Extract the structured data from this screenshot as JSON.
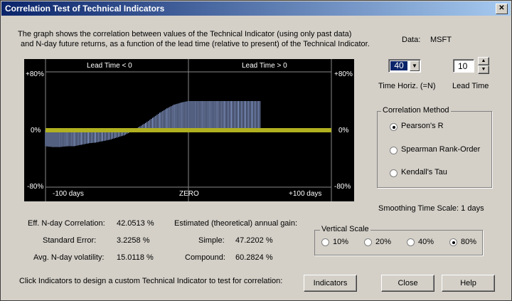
{
  "window": {
    "title": "Correlation Test of Technical Indicators"
  },
  "description": {
    "line1": "The graph shows the correlation between values of the Technical Indicator (using only past data)",
    "line2": "and N-day future returns, as a function of the lead time (relative to present) of the Technical Indicator."
  },
  "data_label": "Data:",
  "data_value": "MSFT",
  "controls": {
    "time_horiz_value": "40",
    "time_horiz_label": "Time Horiz. (=N)",
    "lead_time_value": "10",
    "lead_time_label": "Lead Time"
  },
  "correlation_method": {
    "title": "Correlation Method",
    "options": [
      {
        "label": "Pearson's R",
        "selected": true
      },
      {
        "label": "Spearman Rank-Order",
        "selected": false
      },
      {
        "label": "Kendall's Tau",
        "selected": false
      }
    ]
  },
  "smoothing": "Smoothing Time Scale:  1 days",
  "vertical_scale": {
    "title": "Vertical Scale",
    "options": [
      {
        "label": "10%",
        "selected": false
      },
      {
        "label": "20%",
        "selected": false
      },
      {
        "label": "40%",
        "selected": false
      },
      {
        "label": "80%",
        "selected": true
      }
    ]
  },
  "stats": {
    "eff_label": "Eff. N-day Correlation:",
    "eff_value": "42.0513 %",
    "se_label": "Standard Error:",
    "se_value": "3.2258 %",
    "vol_label": "Avg. N-day volatility:",
    "vol_value": "15.0118 %",
    "est_label": "Estimated (theoretical) annual gain:",
    "simple_label": "Simple:",
    "simple_value": "47.2202 %",
    "compound_label": "Compound:",
    "compound_value": "60.2824 %"
  },
  "footer_text": "Click Indicators to design a custom Technical Indicator to test for correlation:",
  "buttons": {
    "indicators": "Indicators",
    "close": "Close",
    "help": "Help"
  },
  "chart_data": {
    "type": "bar",
    "top_left_label": "Lead Time < 0",
    "top_right_label": "Lead Time > 0",
    "y_tick_top": "+80%",
    "y_tick_mid": "0%",
    "y_tick_bottom": "-80%",
    "x_tick_left": "-100 days",
    "x_tick_mid": "ZERO",
    "x_tick_right": "+100 days",
    "x_range": [
      -100,
      100
    ],
    "ylim": [
      -80,
      80
    ],
    "bar_color": "#a8c0ff",
    "zero_band_color": "#b0b020",
    "series": {
      "x": [
        -100,
        -95,
        -90,
        -85,
        -80,
        -75,
        -70,
        -65,
        -60,
        -55,
        -50,
        -45,
        -40,
        -35,
        -30,
        -25,
        -20,
        -15,
        -10,
        -5,
        0,
        5,
        10,
        15,
        20,
        25,
        30,
        35,
        40,
        45,
        50
      ],
      "values": [
        -22,
        -23,
        -23,
        -22,
        -22,
        -20,
        -18,
        -17,
        -15,
        -13,
        -10,
        -7,
        -2,
        4,
        10,
        17,
        24,
        30,
        35,
        38,
        40,
        40,
        40,
        40,
        40,
        40,
        40,
        40,
        40,
        40,
        40
      ]
    }
  }
}
